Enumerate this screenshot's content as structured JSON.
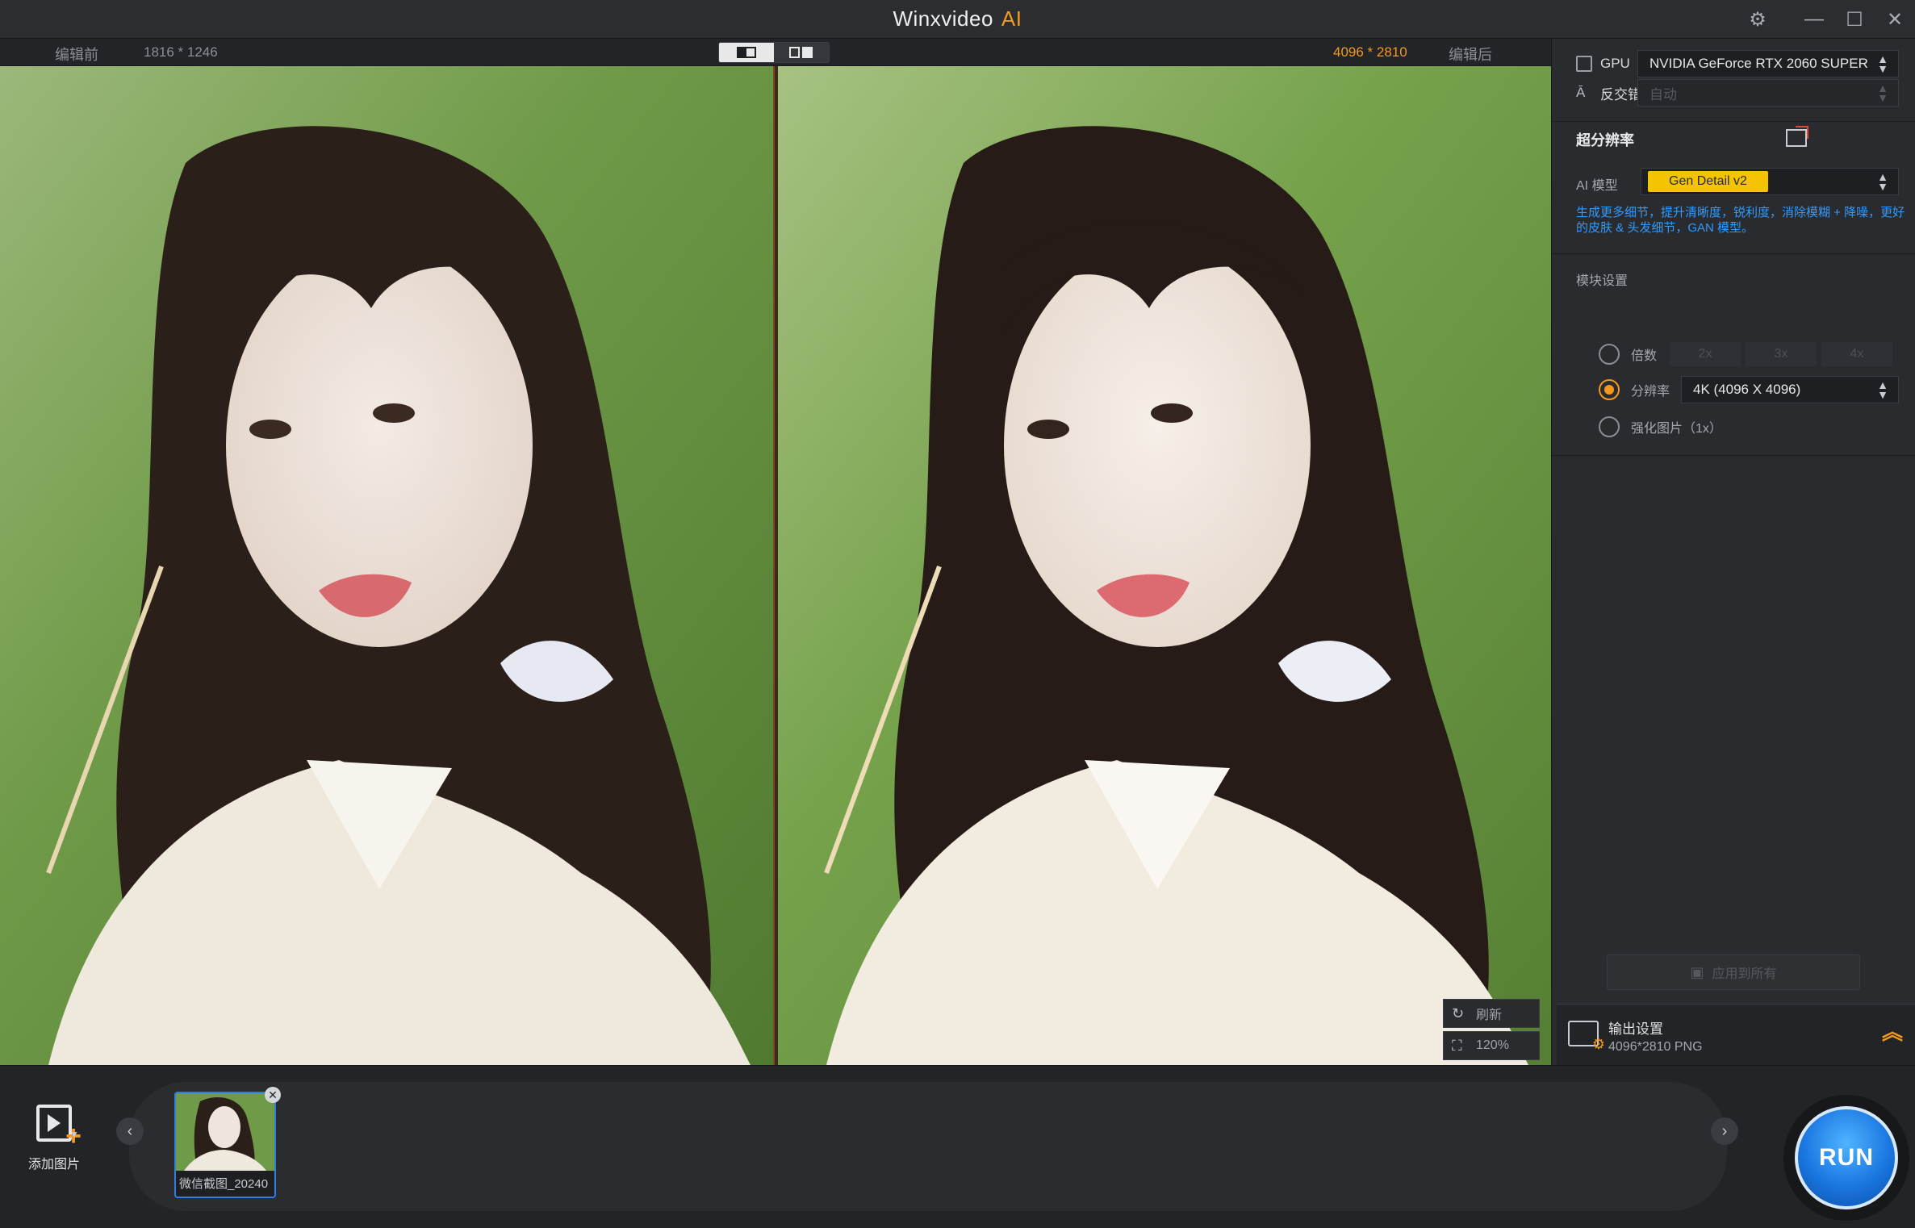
{
  "app": {
    "title": "Winxvideo",
    "title_ai": "AI"
  },
  "window": {
    "settings": "⚙",
    "minimize": "—",
    "maximize": "☐",
    "close": "✕"
  },
  "preview": {
    "before_label": "编辑前",
    "before_res": "1816 * 1246",
    "after_res": "4096 * 2810",
    "after_label": "编辑后",
    "refresh_label": "刷新",
    "zoom_label": "120%"
  },
  "hardware": {
    "gpu_label": "GPU",
    "gpu_value": "NVIDIA GeForce RTX 2060 SUPER",
    "deinterlace_label": "反交错",
    "deinterlace_value": "自动"
  },
  "super_res": {
    "title": "超分辨率",
    "model_label": "AI 模型",
    "model_value": "Gen Detail v2",
    "description": "生成更多细节，提升清晰度，锐利度，消除模糊 + 降噪，更好的皮肤 & 头发细节，GAN 模型。"
  },
  "mode": {
    "title": "模块设置",
    "scale_label": "倍数",
    "scale_options": [
      "2x",
      "3x",
      "4x"
    ],
    "resolution_label": "分辨率",
    "resolution_value": "4K (4096 X 4096)",
    "enhance_label": "强化图片（1x）"
  },
  "apply_all": "应用到所有",
  "output": {
    "title": "输出设置",
    "summary": "4096*2810  PNG"
  },
  "bottom": {
    "add_label": "添加图片",
    "thumb_label": "微信截图_20240",
    "run_label": "RUN"
  },
  "colors": {
    "accent": "#f39a1e",
    "link": "#2f9bff",
    "model_chip": "#f5c400",
    "run": "#1a76e0"
  }
}
